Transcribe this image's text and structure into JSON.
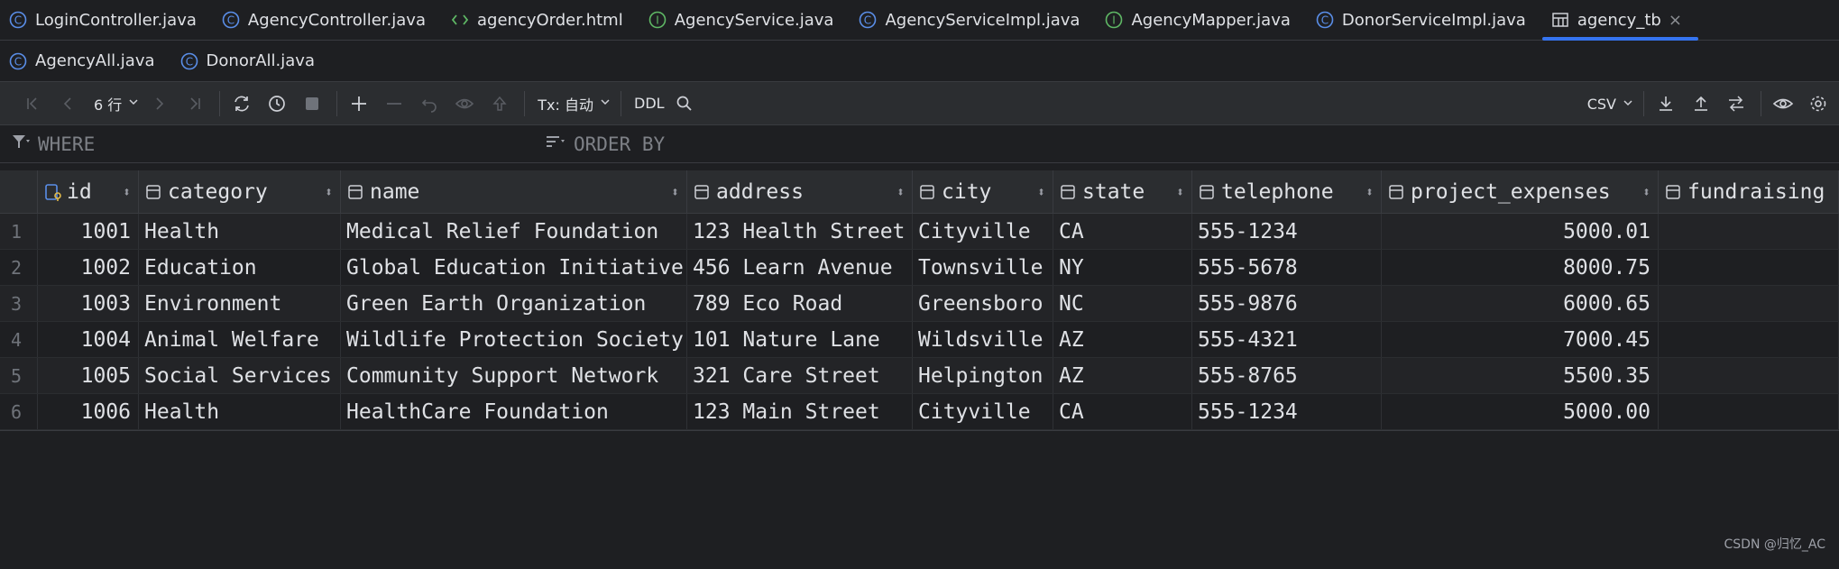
{
  "tabs_row1": [
    {
      "label": "LoginController.java",
      "icon": "class-icon",
      "active": false
    },
    {
      "label": "AgencyController.java",
      "icon": "class-icon",
      "active": false
    },
    {
      "label": "agencyOrder.html",
      "icon": "html-icon",
      "active": false
    },
    {
      "label": "AgencyService.java",
      "icon": "interface-icon",
      "active": false
    },
    {
      "label": "AgencyServiceImpl.java",
      "icon": "class-icon",
      "active": false
    },
    {
      "label": "AgencyMapper.java",
      "icon": "interface-icon",
      "active": false
    },
    {
      "label": "DonorServiceImpl.java",
      "icon": "class-icon",
      "active": false
    },
    {
      "label": "agency_tb",
      "icon": "table-icon",
      "active": true,
      "close": "×"
    }
  ],
  "tabs_row2": [
    {
      "label": "AgencyAll.java",
      "icon": "class-icon"
    },
    {
      "label": "DonorAll.java",
      "icon": "class-icon"
    }
  ],
  "toolbar": {
    "rows_label": "6 行",
    "tx_label": "Tx: 自动",
    "ddl_label": "DDL",
    "format_label": "CSV"
  },
  "filter": {
    "where_placeholder": "WHERE",
    "orderby_placeholder": "ORDER BY"
  },
  "table": {
    "columns": [
      "id",
      "category",
      "name",
      "address",
      "city",
      "state",
      "telephone",
      "project_expenses",
      "fundraising"
    ],
    "rows": [
      {
        "num": "1",
        "cells": [
          "1001",
          "Health",
          "Medical Relief Foundation",
          "123 Health Street",
          "Cityville",
          "CA",
          "555-1234",
          "5000.01",
          ""
        ]
      },
      {
        "num": "2",
        "cells": [
          "1002",
          "Education",
          "Global Education Initiative",
          "456 Learn Avenue",
          "Townsville",
          "NY",
          "555-5678",
          "8000.75",
          ""
        ]
      },
      {
        "num": "3",
        "cells": [
          "1003",
          "Environment",
          "Green Earth Organization",
          "789 Eco Road",
          "Greensboro",
          "NC",
          "555-9876",
          "6000.65",
          ""
        ]
      },
      {
        "num": "4",
        "cells": [
          "1004",
          "Animal Welfare",
          "Wildlife Protection Society",
          "101 Nature Lane",
          "Wildsville",
          "AZ",
          "555-4321",
          "7000.45",
          ""
        ]
      },
      {
        "num": "5",
        "cells": [
          "1005",
          "Social Services",
          "Community Support Network",
          "321 Care Street",
          "Helpington",
          "AZ",
          "555-8765",
          "5500.35",
          ""
        ]
      },
      {
        "num": "6",
        "cells": [
          "1006",
          "Health",
          "HealthCare Foundation",
          "123 Main Street",
          "Cityville",
          "CA",
          "555-1234",
          "5000.00",
          ""
        ]
      }
    ]
  },
  "watermark": "CSDN @归忆_AC",
  "colors": {
    "accent": "#3574f0",
    "background": "#1e1f22",
    "toolbar": "#2b2d30"
  }
}
